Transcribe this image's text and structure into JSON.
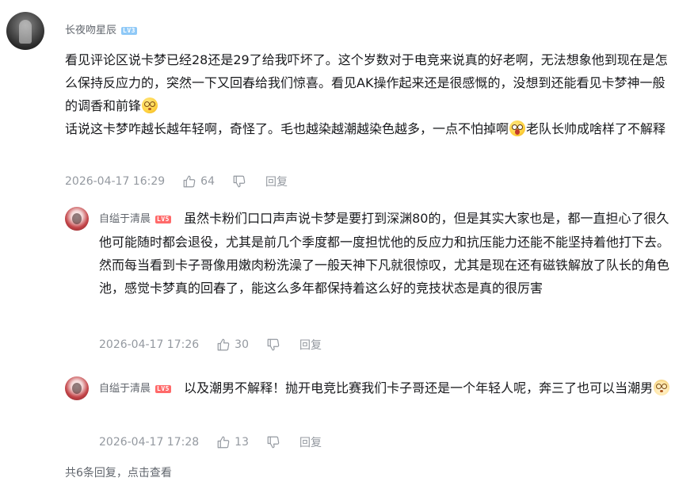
{
  "main_comment": {
    "username": "长夜吻星辰",
    "level": "LV3",
    "text_part1": "看见评论区说卡梦已经28还是29了给我吓坏了。这个岁数对于电竞来说真的好老啊，无法想象他到现在是怎么保持反应力的，突然一下又回春给我们惊喜。看见AK操作起来还是很感慨的，没想到还能看见卡梦神一般的调香和前锋",
    "text_part2": "话说这卡梦咋越长越年轻啊，奇怪了。毛也越染越潮越染色越多，一点不怕掉啊",
    "text_part3": "老队长帅成啥样了不解释",
    "timestamp": "2026-04-17 16:29",
    "likes": "64",
    "reply_label": "回复"
  },
  "replies": [
    {
      "username": "自缢于清晨",
      "level": "LV5",
      "text": "虽然卡粉们口口声声说卡梦是要打到深渊80的，但是其实大家也是，都一直担心了很久他可能随时都会退役，尤其是前几个季度都一度担忧他的反应力和抗压能力还能不能坚持着他打下去。然而每当看到卡子哥像用嫩肉粉洗澡了一般天神下凡就很惊叹，尤其是现在还有磁铁解放了队长的角色池，感觉卡梦真的回春了，能这么多年都保持着这么好的竞技状态是真的很厉害",
      "timestamp": "2026-04-17 17:26",
      "likes": "30",
      "reply_label": "回复"
    },
    {
      "username": "自缢于清晨",
      "level": "LV5",
      "text": "以及潮男不解释！抛开电竞比赛我们卡子哥还是一个年轻人呢，奔三了也可以当潮男",
      "timestamp": "2026-04-17 17:28",
      "likes": "13",
      "reply_label": "回复"
    }
  ],
  "footer": {
    "view_more": "共6条回复，点击查看"
  },
  "icons": {
    "like": "thumbs-up-icon",
    "dislike": "thumbs-down-icon",
    "emoji1": "dizzy-face-emoji",
    "emoji2": "surprised-face-emoji",
    "emoji3": "rice-ball-emoji"
  },
  "colors": {
    "text": "#18191c",
    "meta": "#9499a0",
    "username": "#61666d",
    "level_blue": "#8fc9f7",
    "level_red": "#ff6a6a"
  }
}
